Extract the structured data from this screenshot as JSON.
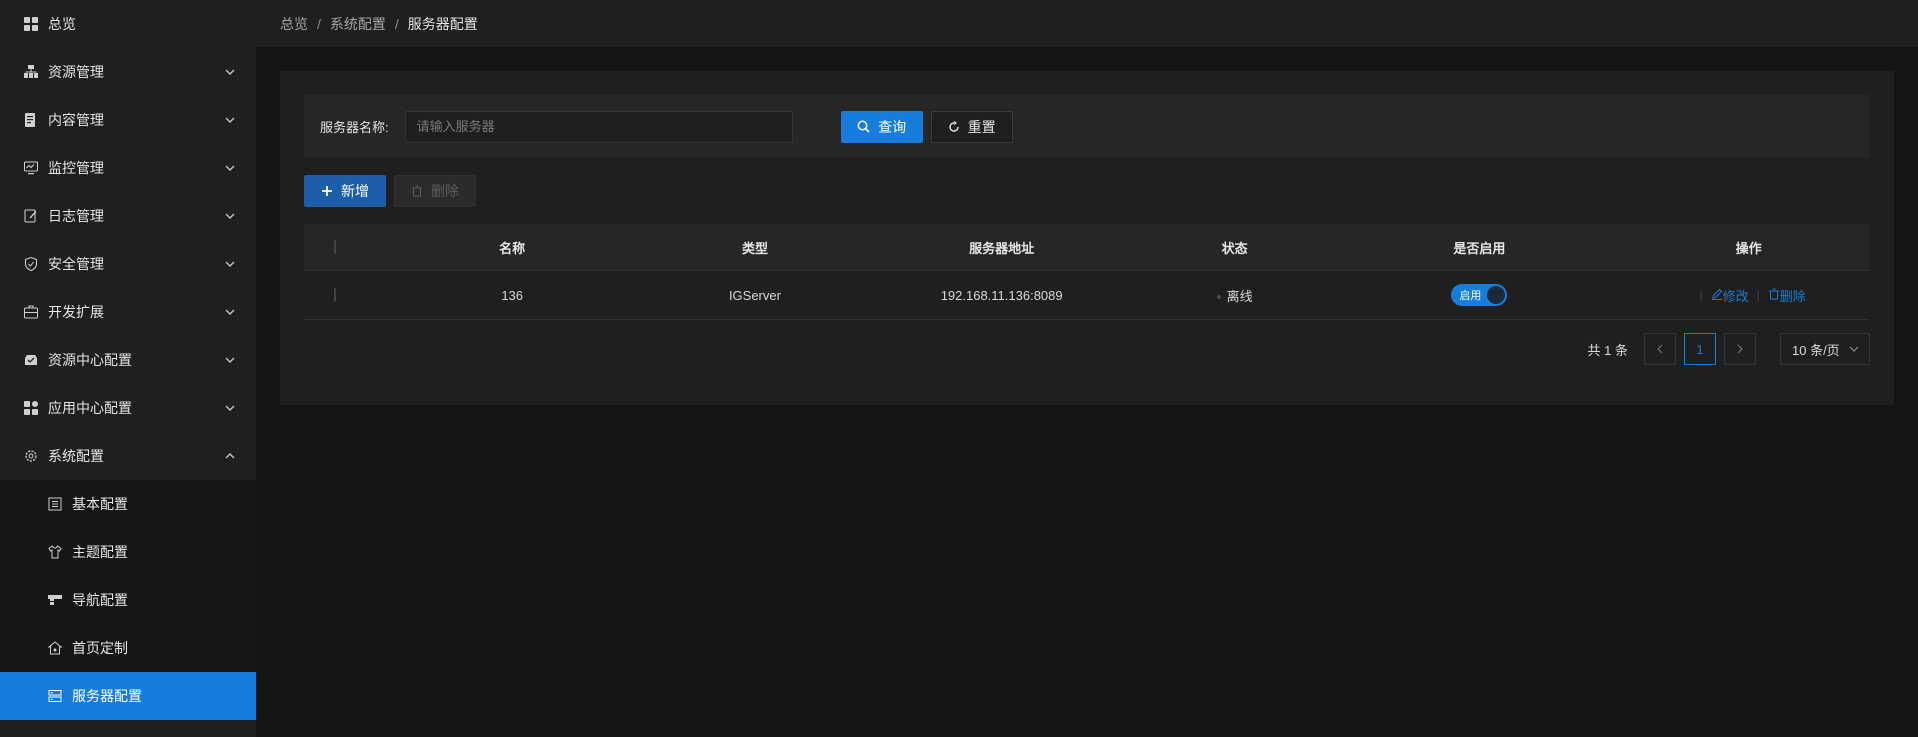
{
  "sidebar": {
    "items": [
      {
        "label": "总览",
        "icon": "dashboard-icon"
      },
      {
        "label": "资源管理",
        "icon": "resource-icon"
      },
      {
        "label": "内容管理",
        "icon": "content-icon"
      },
      {
        "label": "监控管理",
        "icon": "monitor-icon"
      },
      {
        "label": "日志管理",
        "icon": "log-icon"
      },
      {
        "label": "安全管理",
        "icon": "shield-icon"
      },
      {
        "label": "开发扩展",
        "icon": "toolbox-icon"
      },
      {
        "label": "资源中心配置",
        "icon": "resource-center-icon"
      },
      {
        "label": "应用中心配置",
        "icon": "apps-icon"
      },
      {
        "label": "系统配置",
        "icon": "gear-icon"
      }
    ],
    "submenu": [
      {
        "label": "基本配置",
        "icon": "basic-config-icon"
      },
      {
        "label": "主题配置",
        "icon": "shirt-icon"
      },
      {
        "label": "导航配置",
        "icon": "navigation-icon"
      },
      {
        "label": "首页定制",
        "icon": "home-icon"
      },
      {
        "label": "服务器配置",
        "icon": "server-icon"
      }
    ]
  },
  "breadcrumb": {
    "items": [
      "总览",
      "系统配置",
      "服务器配置"
    ],
    "separator": "/"
  },
  "search": {
    "label": "服务器名称:",
    "placeholder": "请输入服务器",
    "value": "",
    "query_label": "查询",
    "reset_label": "重置"
  },
  "toolbar": {
    "add_label": "新增",
    "delete_label": "删除"
  },
  "table": {
    "columns": [
      "名称",
      "类型",
      "服务器地址",
      "状态",
      "是否启用",
      "操作"
    ],
    "rows": [
      {
        "name": "136",
        "type": "IGServer",
        "address": "192.168.11.136:8089",
        "status": "离线",
        "enabled_label": "启用",
        "edit_label": "修改",
        "delete_label": "删除"
      }
    ]
  },
  "pagination": {
    "total_text": "共 1 条",
    "current_page": "1",
    "page_size": "10 条/页"
  },
  "colors": {
    "accent": "#177ddc",
    "background": "#141414",
    "panel": "#1f1f1f"
  }
}
